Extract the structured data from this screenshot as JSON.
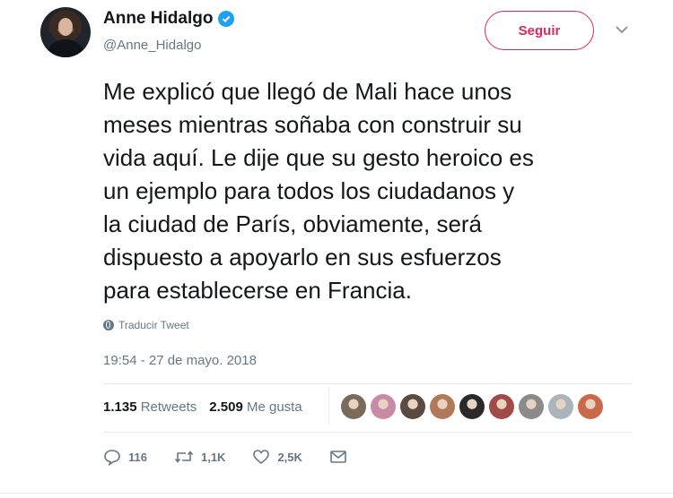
{
  "user": {
    "name": "Anne Hidalgo",
    "handle": "@Anne_Hidalgo",
    "verified_icon": "verified-badge-icon"
  },
  "follow_button": {
    "label": "Seguir",
    "color": "#e0245e"
  },
  "menu": {
    "icon": "chevron-down-icon"
  },
  "tweet": {
    "lines": [
      "Me explicó que llegó de Mali hace unos",
      "meses mientras soñaba con construir su",
      "vida aquí. Le dije que su gesto heroico es",
      "un ejemplo para todos los ciudadanos y",
      "la ciudad de París, obviamente, será",
      "dispuesto a apoyarlo en sus esfuerzos",
      "para establecerse en Francia."
    ],
    "translate_label": "Traducir Tweet",
    "timestamp": "19:54 - 27 de mayo. 2018"
  },
  "stats": {
    "retweets_count": "1.135",
    "retweets_label": "Retweets",
    "likes_count": "2.509",
    "likes_label": "Me gusta"
  },
  "likers": {
    "avatars": [
      {
        "color": "#7a6a5c"
      },
      {
        "color": "#c98aa8"
      },
      {
        "color": "#5a4a40"
      },
      {
        "color": "#b07a5a"
      },
      {
        "color": "#2a2a2a"
      },
      {
        "color": "#a04a4a"
      },
      {
        "color": "#8a8a8a"
      },
      {
        "color": "#aab4bd"
      },
      {
        "color": "#c86a4a"
      }
    ]
  },
  "actions": {
    "reply_count": "116",
    "retweet_count": "1,1K",
    "like_count": "2,5K"
  },
  "colors": {
    "text": "#14171a",
    "muted": "#657786",
    "accent": "#1da1f2",
    "divider": "#e6ecf0"
  }
}
